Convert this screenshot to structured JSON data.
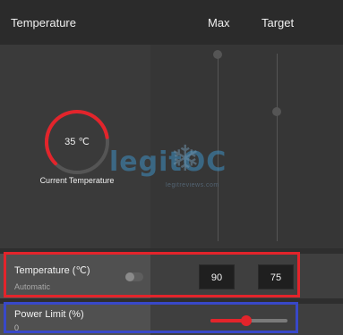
{
  "header": {
    "title": "Temperature",
    "col_max": "Max",
    "col_target": "Target"
  },
  "gauge": {
    "value_text": "35 ℃",
    "label": "Current Temperature",
    "fraction": 0.6,
    "color": "#e3242b"
  },
  "watermark": {
    "text": "legitOC",
    "sub": "legitreviews.com"
  },
  "temperature_row": {
    "title": "Temperature (℃)",
    "mode": "Automatic",
    "max_value": "90",
    "target_value": "75",
    "toggle_on": false
  },
  "power_row": {
    "title": "Power Limit (%)",
    "value": "0",
    "slider_fraction": 0.47
  },
  "colors": {
    "accent": "#e3242b",
    "highlight_red": "#e3242b",
    "highlight_blue": "#3848c8"
  }
}
